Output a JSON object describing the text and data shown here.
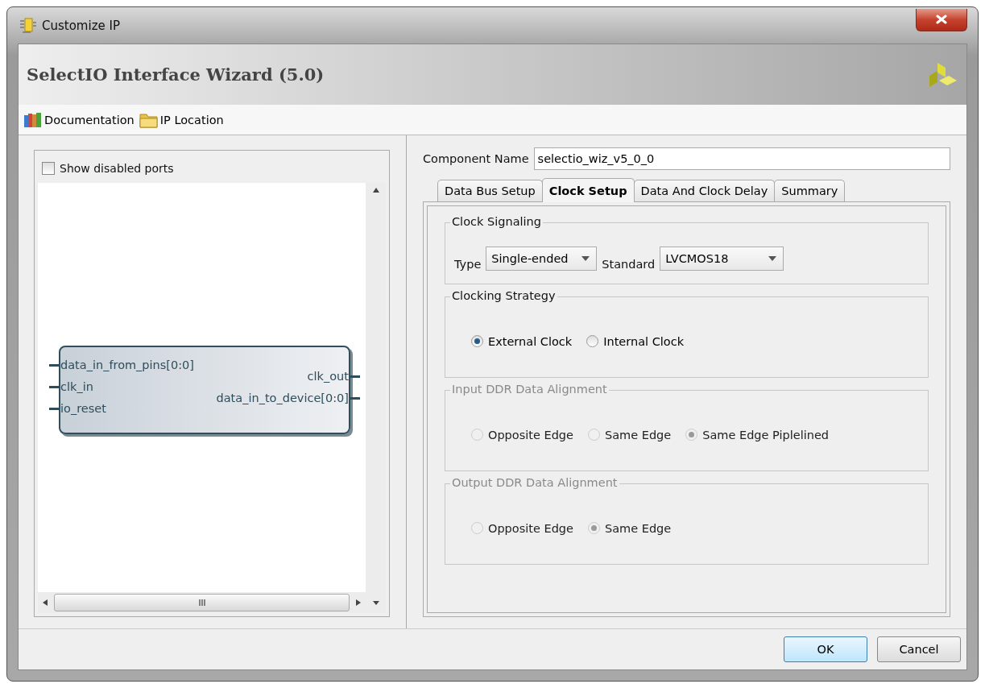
{
  "window": {
    "title": "Customize IP"
  },
  "header": {
    "title": "SelectIO Interface Wizard (5.0)"
  },
  "toolbar": [
    {
      "label": "Documentation",
      "kind": "books"
    },
    {
      "label": "IP Location",
      "kind": "folder"
    }
  ],
  "symbol_panel": {
    "show_disabled_ports": {
      "label": "Show disabled ports",
      "checked": false
    },
    "block": {
      "inputs": [
        "data_in_from_pins[0:0]",
        "clk_in",
        "io_reset"
      ],
      "outputs": [
        "clk_out",
        "data_in_to_device[0:0]"
      ]
    }
  },
  "component_name": {
    "label": "Component Name",
    "value": "selectio_wiz_v5_0_0"
  },
  "tabs": [
    {
      "label": "Data Bus Setup",
      "selected": false
    },
    {
      "label": "Clock Setup",
      "selected": true
    },
    {
      "label": "Data And Clock Delay",
      "selected": false
    },
    {
      "label": "Summary",
      "selected": false
    }
  ],
  "groups": [
    {
      "title": "Clock Signaling",
      "kind": "fields",
      "disabled": false,
      "fields": [
        {
          "label": "Type",
          "value": "Single-ended"
        },
        {
          "label": "Standard",
          "value": "LVCMOS18"
        }
      ]
    },
    {
      "title": "Clocking Strategy",
      "kind": "radios",
      "disabled": false,
      "options": [
        {
          "label": "External Clock",
          "selected": true
        },
        {
          "label": "Internal Clock",
          "selected": false
        }
      ]
    },
    {
      "title": "Input DDR Data Alignment",
      "kind": "radios",
      "disabled": true,
      "options": [
        {
          "label": "Opposite Edge",
          "selected": false
        },
        {
          "label": "Same Edge",
          "selected": false
        },
        {
          "label": "Same Edge Piplelined",
          "selected": true
        }
      ]
    },
    {
      "title": "Output DDR Data Alignment",
      "kind": "radios",
      "disabled": true,
      "options": [
        {
          "label": "Opposite Edge",
          "selected": false
        },
        {
          "label": "Same Edge",
          "selected": true
        }
      ]
    }
  ],
  "buttons": [
    {
      "label": "OK",
      "kind": "default"
    },
    {
      "label": "Cancel",
      "kind": "normal"
    }
  ]
}
